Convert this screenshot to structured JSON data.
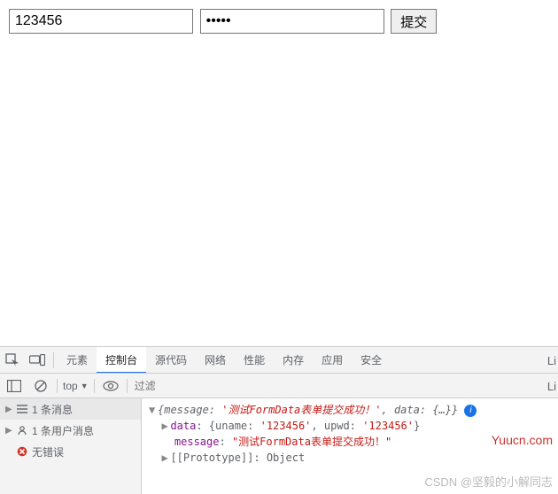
{
  "form": {
    "username_value": "123456",
    "password_value": "12345",
    "submit_label": "提交"
  },
  "devtools": {
    "tabs": {
      "elements": "元素",
      "console": "控制台",
      "sources": "源代码",
      "network": "网络",
      "performance": "性能",
      "memory": "内存",
      "application": "应用",
      "security": "安全",
      "more_cut": "Li"
    },
    "toolbar": {
      "context": "top",
      "filter_placeholder": "过滤",
      "more_cut": "Li"
    },
    "sidebar": {
      "messages": "1 条消息",
      "user_messages": "1 条用户消息",
      "no_errors": "无错误"
    },
    "console": {
      "summary_pre": "{message: ",
      "summary_msg": "'测试FormData表单提交成功！'",
      "summary_mid": ", data: ",
      "summary_data": "{…}",
      "summary_post": "}",
      "data_key": "data",
      "data_line_pre": ": {uname: ",
      "data_uname": "'123456'",
      "data_line_mid": ", upwd: ",
      "data_upwd": "'123456'",
      "data_line_post_cut": "}",
      "message_key": "message",
      "message_val": "\"测试FormData表单提交成功！\"",
      "proto_key": "[[Prototype]]",
      "proto_val": ": Object"
    }
  },
  "watermarks": {
    "yuucn": "Yuucn.com",
    "csdn": "CSDN @坚毅的小解同志"
  }
}
